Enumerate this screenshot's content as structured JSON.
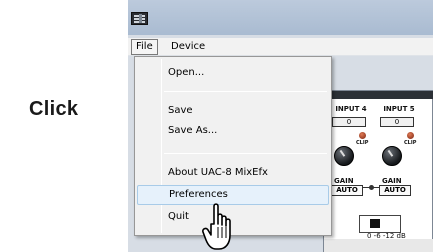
{
  "step_label": "Click",
  "window": {
    "menubar": {
      "file": "File",
      "device": "Device"
    },
    "file_menu": {
      "items": [
        {
          "label": "Open..."
        },
        {
          "label": "Save"
        },
        {
          "label": "Save As..."
        },
        {
          "label": "About UAC-8 MixEfx"
        },
        {
          "label": "Preferences",
          "highlighted": true
        },
        {
          "label": "Quit"
        }
      ]
    },
    "mixer": {
      "channels": [
        {
          "name": "INPUT 4",
          "value": "0",
          "clip": "CLIP",
          "gain": "GAIN",
          "auto": "AUTO"
        },
        {
          "name": "INPUT 5",
          "value": "0",
          "clip": "CLIP",
          "gain": "GAIN",
          "auto": "AUTO"
        }
      ],
      "db_readout": "0 -6 -12 dB"
    }
  },
  "colors": {
    "titlebar": "#b3c3d7",
    "menu_background": "#f1f1f1",
    "highlight_fill": "#e6f1fb",
    "highlight_border": "#a8cbe8"
  },
  "icons": [
    "app-icon",
    "hand-pointer-icon"
  ]
}
